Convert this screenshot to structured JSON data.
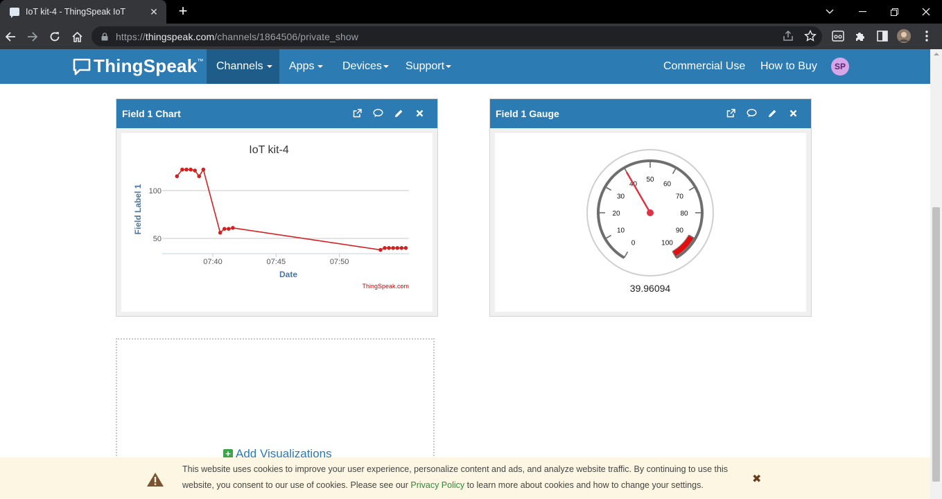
{
  "browser": {
    "tab_title": "IoT kit-4 - ThingSpeak IoT",
    "new_tab_label": "+",
    "url_prefix": "https://",
    "url_host": "thingspeak.com",
    "url_path": "/channels/1864506/private_show"
  },
  "nav": {
    "logo": "ThingSpeak",
    "logo_tm": "™",
    "items": [
      {
        "label": "Channels",
        "active": true,
        "has_caret": true
      },
      {
        "label": "Apps",
        "has_caret": true
      },
      {
        "label": "Devices",
        "has_caret": true
      },
      {
        "label": "Support",
        "has_caret": true
      }
    ],
    "right_items": [
      "Commercial Use",
      "How to Buy"
    ],
    "avatar_initials": "SP"
  },
  "widgets": {
    "chart_title_bar": "Field 1 Chart",
    "gauge_title_bar": "Field 1 Gauge",
    "add_visualizations": "Add Visualizations"
  },
  "chart_data": {
    "type": "line",
    "title": "IoT kit-4",
    "xlabel": "Date",
    "ylabel": "Field Label 1",
    "credit": "ThingSpeak.com",
    "x_ticks": [
      "07:40",
      "07:45",
      "07:50"
    ],
    "y_ticks": [
      50,
      100
    ],
    "color": "#d62020",
    "series": [
      {
        "points": [
          [
            "07:37:10",
            115
          ],
          [
            "07:37:35",
            122
          ],
          [
            "07:37:55",
            122
          ],
          [
            "07:38:15",
            122
          ],
          [
            "07:38:35",
            121
          ],
          [
            "07:38:55",
            115
          ],
          [
            "07:39:15",
            122
          ],
          [
            "07:40:35",
            56
          ],
          [
            "07:40:55",
            60
          ],
          [
            "07:41:15",
            60
          ],
          [
            "07:41:35",
            61
          ],
          [
            "07:53:15",
            38
          ],
          [
            "07:53:35",
            40
          ],
          [
            "07:53:55",
            40
          ],
          [
            "07:54:15",
            40
          ],
          [
            "07:54:35",
            40
          ],
          [
            "07:54:55",
            40
          ],
          [
            "07:55:15",
            40
          ]
        ]
      }
    ]
  },
  "gauge": {
    "value": "39.96094",
    "min": 0,
    "max": 100,
    "ticks": [
      "0",
      "10",
      "20",
      "30",
      "40",
      "50",
      "60",
      "70",
      "80",
      "90",
      "100"
    ],
    "danger_from": 90,
    "danger_color": "#e01010",
    "needle_color": "#dd3344"
  },
  "cookie": {
    "text_before": "This website uses cookies to improve your user experience, personalize content and ads, and analyze website traffic. By continuing to use this website, you consent to our use of cookies. Please see our ",
    "link": "Privacy Policy",
    "text_after": " to learn more about cookies and how to change your settings.",
    "close": "✖"
  },
  "colors": {
    "brand": "#2c7bb3",
    "brand_active": "#1e5d8a",
    "series": "#d62020"
  }
}
